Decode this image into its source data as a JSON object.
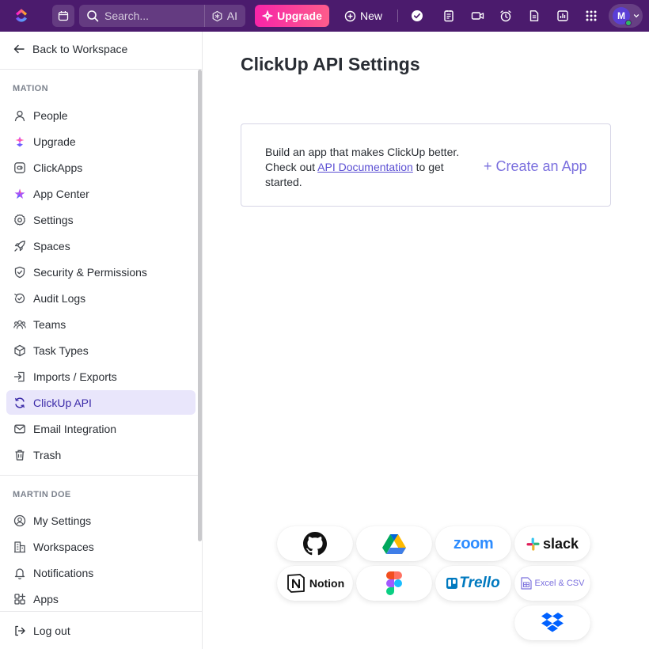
{
  "topbar": {
    "search_placeholder": "Search...",
    "ai_label": "AI",
    "upgrade_label": "Upgrade",
    "new_label": "New",
    "avatar_initial": "M",
    "colors": {
      "bar": "#4b1b6d",
      "upgrade": "#f724a8"
    }
  },
  "sidebar": {
    "back_label": "Back to Workspace",
    "workspace_section": "MATION",
    "workspace_items": [
      {
        "label": "People",
        "icon": "person-icon"
      },
      {
        "label": "Upgrade",
        "icon": "upgrade-icon"
      },
      {
        "label": "ClickApps",
        "icon": "clickapps-icon"
      },
      {
        "label": "App Center",
        "icon": "app-center-icon"
      },
      {
        "label": "Settings",
        "icon": "gear-icon"
      },
      {
        "label": "Spaces",
        "icon": "rocket-icon"
      },
      {
        "label": "Security & Permissions",
        "icon": "shield-icon"
      },
      {
        "label": "Audit Logs",
        "icon": "audit-icon"
      },
      {
        "label": "Teams",
        "icon": "team-icon"
      },
      {
        "label": "Task Types",
        "icon": "cube-icon"
      },
      {
        "label": "Imports / Exports",
        "icon": "import-icon"
      },
      {
        "label": "ClickUp API",
        "icon": "sync-icon",
        "active": true
      },
      {
        "label": "Email Integration",
        "icon": "mail-icon"
      },
      {
        "label": "Trash",
        "icon": "trash-icon"
      }
    ],
    "user_section": "MARTIN DOE",
    "user_items": [
      {
        "label": "My Settings",
        "icon": "user-circle-icon"
      },
      {
        "label": "Workspaces",
        "icon": "building-icon"
      },
      {
        "label": "Notifications",
        "icon": "bell-icon"
      },
      {
        "label": "Apps",
        "icon": "apps-icon"
      }
    ],
    "logout_label": "Log out"
  },
  "main": {
    "title": "ClickUp API Settings",
    "card": {
      "text_before": "Build an app that makes ClickUp better. Check out ",
      "link": "API Documentation",
      "text_after": " to get started.",
      "create_label": "+ Create an App"
    },
    "integrations": {
      "notion": "Notion",
      "zoom": "zoom",
      "slack": "slack",
      "trello": "Trello",
      "excel": "Excel & CSV"
    }
  }
}
